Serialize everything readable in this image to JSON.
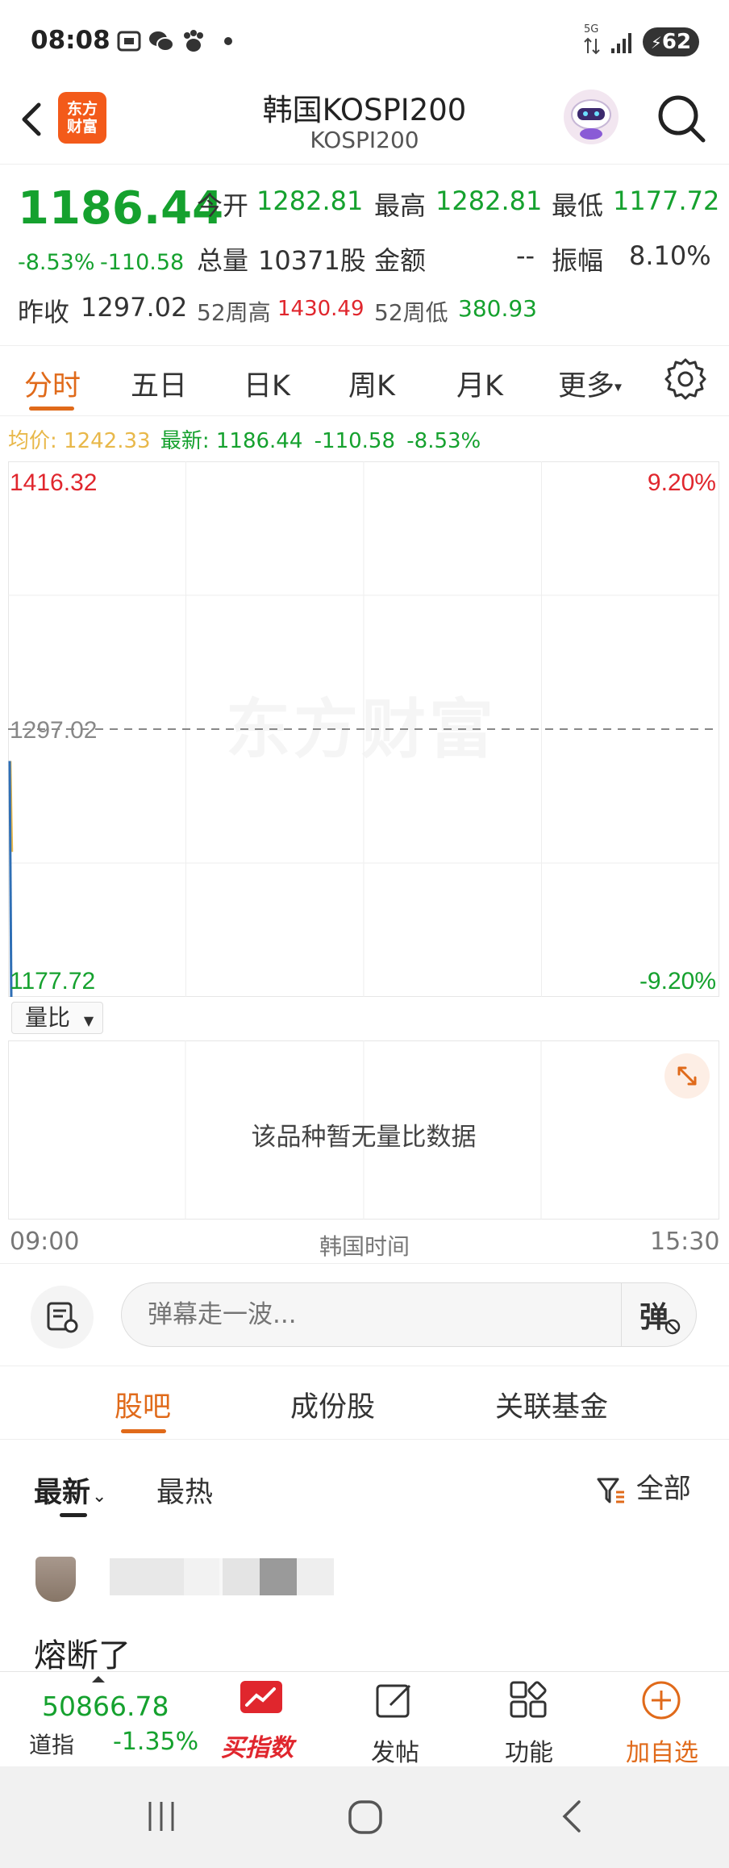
{
  "status_bar": {
    "time": "08:08",
    "network_label": "5G",
    "battery": "62"
  },
  "header": {
    "back_label": "<",
    "logo_text": "东方财富",
    "title": "韩国KOSPI200",
    "subtitle": "KOSPI200"
  },
  "quote": {
    "price": "1186.44",
    "change_pct": "-8.53%",
    "change_abs": "-110.58",
    "open_label": "今开",
    "open": "1282.81",
    "high_label": "最高",
    "high": "1282.81",
    "low_label": "最低",
    "low": "1177.72",
    "volume_label": "总量",
    "volume": "10371股",
    "amount_label": "金额",
    "amount": "--",
    "amplitude_label": "振幅",
    "amplitude": "8.10%",
    "prev_close_label": "昨收",
    "prev_close": "1297.02",
    "week52_high_label": "52周高",
    "week52_high": "1430.49",
    "week52_low_label": "52周低",
    "week52_low": "380.93"
  },
  "chart_tabs": {
    "items": [
      "分时",
      "五日",
      "日K",
      "周K",
      "月K",
      "更多"
    ],
    "active": "分时"
  },
  "info_line": {
    "avg_label": "均价:",
    "avg": "1242.33",
    "latest_label": "最新:",
    "latest": "1186.44",
    "chg": "-110.58",
    "pct": "-8.53%"
  },
  "chart_data": {
    "type": "line",
    "y_top_label": "1416.32",
    "y_mid_label": "1297.02",
    "y_bottom_label": "1177.72",
    "pct_top_label": "9.20%",
    "pct_bottom_label": "-9.20%",
    "ylim": [
      1177.72,
      1416.32
    ],
    "reference_line": 1297.02,
    "x_start_label": "09:00",
    "x_end_label": "15:30",
    "x_mid_label": "韩国时间",
    "series": [
      {
        "values": [
          1282.81,
          1177.72
        ]
      },
      {
        "values": [
          1282.81,
          1242.33
        ]
      }
    ],
    "grid": true,
    "watermark": "东方财富"
  },
  "volume_panel": {
    "selector_label": "量比",
    "empty_message": "该品种暂无量比数据"
  },
  "danmaku": {
    "placeholder": "弹幕走一波...",
    "send_label": "弹"
  },
  "forum_tabs": {
    "items": [
      "股吧",
      "成份股",
      "关联基金"
    ],
    "active": "股吧"
  },
  "sort": {
    "latest_label": "最新",
    "hot_label": "最热",
    "filter_label": "全部"
  },
  "post": {
    "text": "熔断了"
  },
  "bottom_nav": {
    "dji_value": "50866.78",
    "dji_label": "道指",
    "dji_pct": "-1.35%",
    "buy_index_label": "买指数",
    "post_label": "发帖",
    "func_label": "功能",
    "add_label": "加自选"
  },
  "colors": {
    "down": "#15a12e",
    "up": "#e0262d",
    "accent": "#e06a1a",
    "avg_line": "#e8b84a",
    "price_line": "#2f6fb5"
  }
}
